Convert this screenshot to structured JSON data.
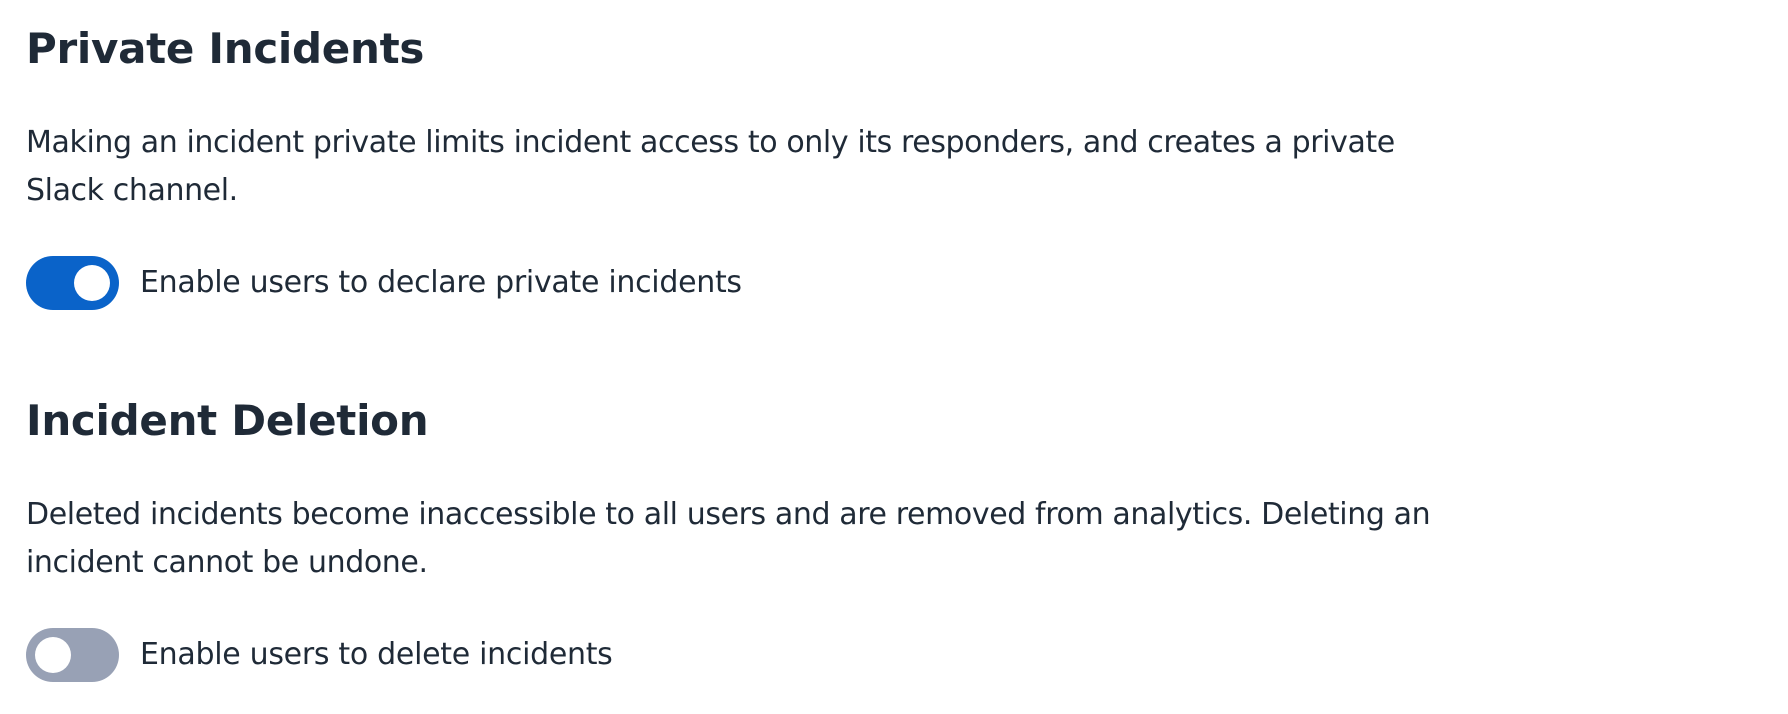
{
  "private_incidents": {
    "title": "Private Incidents",
    "description": "Making an incident private limits incident access to only its responders, and creates a private Slack channel.",
    "toggle": {
      "label": "Enable users to declare private incidents",
      "checked": true
    }
  },
  "incident_deletion": {
    "title": "Incident Deletion",
    "description": "Deleted incidents become inaccessible to all users and are removed from analytics. Deleting an incident cannot be undone.",
    "toggle": {
      "label": "Enable users to delete incidents",
      "checked": false
    }
  },
  "colors": {
    "toggle_on": "#0a63c9",
    "toggle_off": "#98a1b5",
    "text": "#1f2a37"
  }
}
